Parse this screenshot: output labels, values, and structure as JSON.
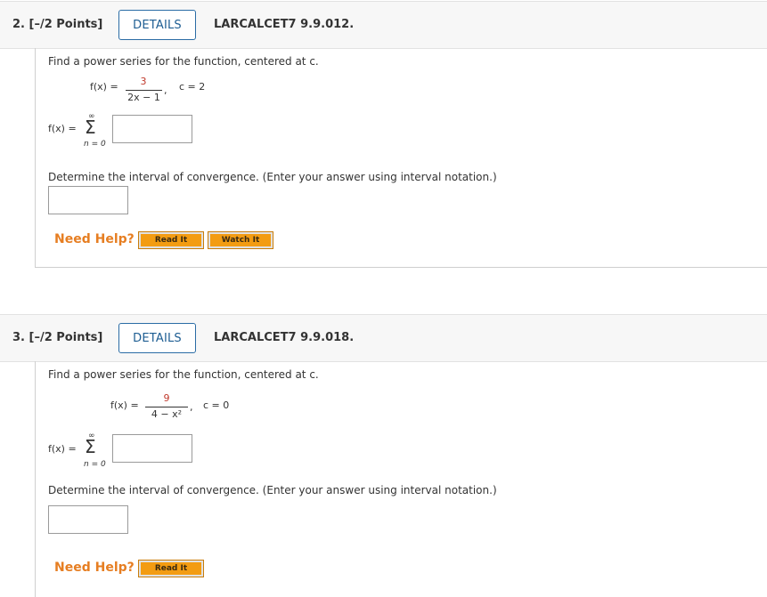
{
  "questions": [
    {
      "number": "2.",
      "points": "[–/2 Points]",
      "details_label": "DETAILS",
      "code": "LARCALCET7 9.9.012.",
      "prompt": "Find a power series for the function, centered at c.",
      "fx_label": "f(x) =",
      "numerator": "3",
      "denominator": "2x − 1",
      "comma": ",",
      "center": "c = 2",
      "sum_label": "f(x) =",
      "sum_upper": "∞",
      "sum_lower": "n = 0",
      "interval_prompt": "Determine the interval of convergence. (Enter your answer using interval notation.)",
      "need_help": "Need Help?",
      "help_buttons": [
        "Read It",
        "Watch It"
      ]
    },
    {
      "number": "3.",
      "points": "[–/2 Points]",
      "details_label": "DETAILS",
      "code": "LARCALCET7 9.9.018.",
      "prompt": "Find a power series for the function, centered at c.",
      "fx_label": "f(x) =",
      "numerator": "9",
      "denominator": "4 − x²",
      "comma": ",",
      "center": "c = 0",
      "sum_label": "f(x) =",
      "sum_upper": "∞",
      "sum_lower": "n = 0",
      "interval_prompt": "Determine the interval of convergence. (Enter your answer using interval notation.)",
      "need_help": "Need Help?",
      "help_buttons": [
        "Read It"
      ]
    }
  ],
  "colors": {
    "details_border": "#2a6ca5",
    "numerator": "#c0392b",
    "need_help": "#e67e22",
    "help_button": "#f39c12"
  }
}
